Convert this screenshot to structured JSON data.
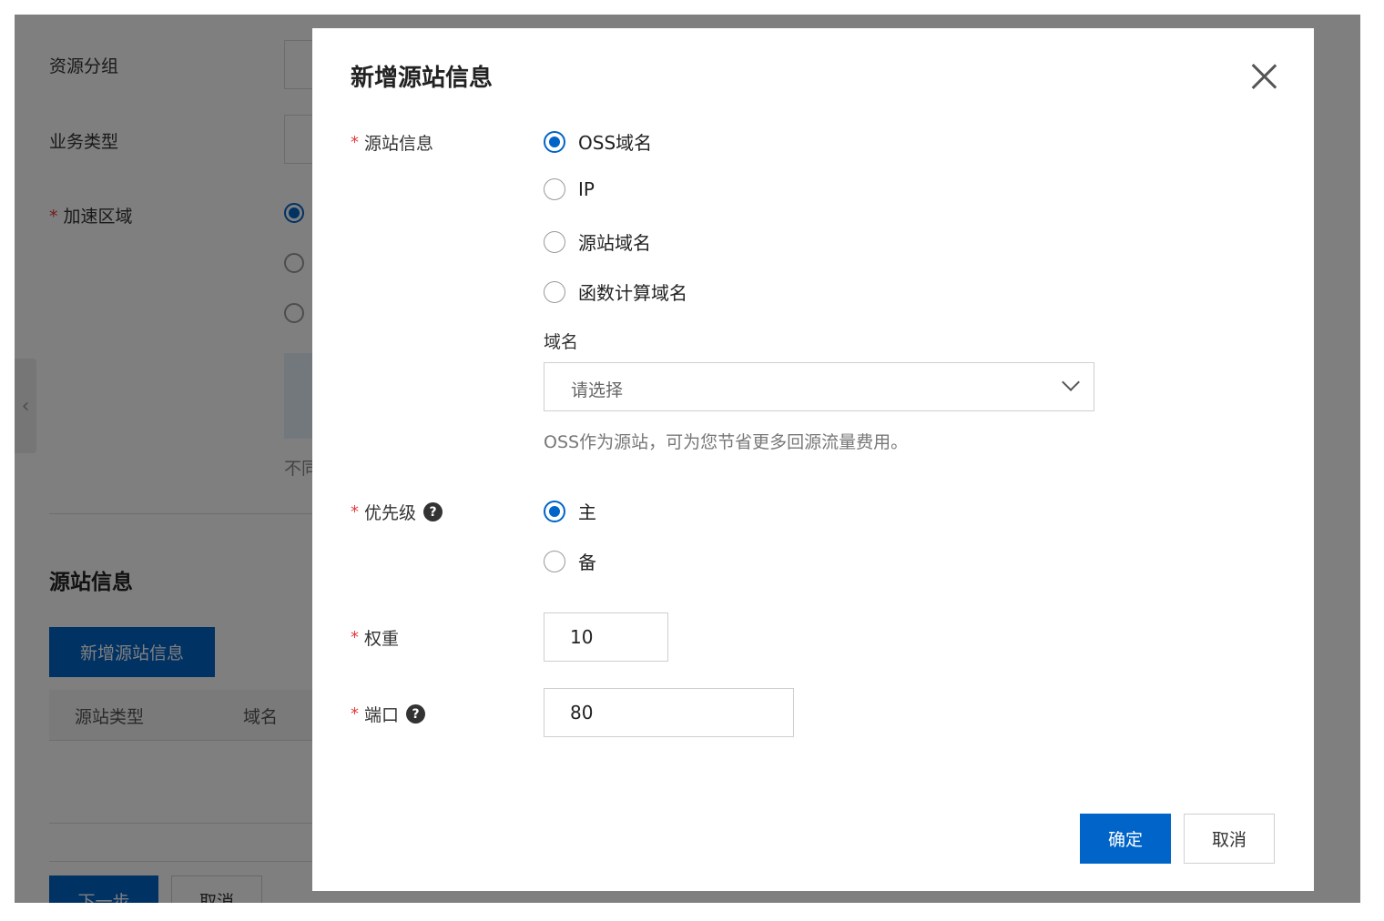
{
  "background": {
    "fields": {
      "resource_group": "资源分组",
      "business_type": "业务类型",
      "accel_region": "加速区域"
    },
    "partial_hint": "不同",
    "section_title": "源站信息",
    "add_origin_button": "新增源站信息",
    "table_headers": [
      "源站类型",
      "域名"
    ],
    "next_button": "下一步",
    "cancel_button": "取消"
  },
  "modal": {
    "title": "新增源站信息",
    "origin_info": {
      "label": "源站信息",
      "options": [
        "OSS域名",
        "IP",
        "源站域名",
        "函数计算域名"
      ],
      "selected": "OSS域名"
    },
    "domain": {
      "label": "域名",
      "placeholder": "请选择",
      "hint": "OSS作为源站，可为您节省更多回源流量费用。"
    },
    "priority": {
      "label": "优先级",
      "options": [
        "主",
        "备"
      ],
      "selected": "主"
    },
    "weight": {
      "label": "权重",
      "value": "10"
    },
    "port": {
      "label": "端口",
      "value": "80"
    },
    "confirm_button": "确定",
    "cancel_button": "取消"
  },
  "colors": {
    "primary": "#0064c8",
    "required": "#e4393c"
  }
}
